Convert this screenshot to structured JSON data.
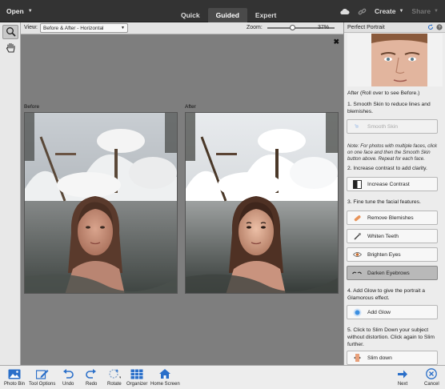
{
  "topbar": {
    "open_label": "Open",
    "modes": [
      "Quick",
      "Guided",
      "Expert"
    ],
    "active_mode": "Guided",
    "create_label": "Create",
    "share_label": "Share"
  },
  "options": {
    "view_label": "View:",
    "view_value": "Before & After - Horizontal",
    "zoom_label": "Zoom:",
    "zoom_value": "37%",
    "zoom_fraction": 0.37
  },
  "canvas": {
    "before_label": "Before",
    "after_label": "After"
  },
  "panel": {
    "title": "Perfect Portrait",
    "intro": "After (Roll over to see Before.)",
    "step1": "1. Smooth Skin to reduce lines and blemishes.",
    "smooth_skin": "Smooth Skin",
    "note": "Note: For photos with multiple faces, click on one face and then the Smooth Skin button above. Repeat for each face.",
    "step2": "2. Increase contrast to add clarity.",
    "increase_contrast": "Increase Contrast",
    "step3": "3. Fine tune the facial features.",
    "remove_blemishes": "Remove Blemishes",
    "whiten_teeth": "Whiten Teeth",
    "brighten_eyes": "Brighten Eyes",
    "darken_eyebrows": "Darken Eyebrows",
    "step4": "4. Add Glow to give the portrait a Glamorous effect.",
    "add_glow": "Add Glow",
    "step5": "5. Click to Slim Down your subject without distortion. Click again to Slim further.",
    "slim_down": "Slim down"
  },
  "bottombar": {
    "photo_bin": "Photo Bin",
    "tool_options": "Tool Options",
    "undo": "Undo",
    "redo": "Redo",
    "rotate": "Rotate",
    "organizer": "Organizer",
    "home_screen": "Home Screen",
    "next": "Next",
    "cancel": "Cancel"
  },
  "colors": {
    "accent_blue": "#2a6fc9",
    "topbar_bg": "#333333",
    "canvas_bg": "#7e7e7e",
    "panel_bg": "#ececec"
  },
  "icons": [
    "search-icon",
    "hand-icon",
    "cloud-icon",
    "link-icon",
    "help-icon",
    "refresh-icon",
    "photo-bin-icon",
    "tool-options-icon",
    "undo-icon",
    "redo-icon",
    "rotate-icon",
    "organizer-icon",
    "home-icon",
    "next-arrow-icon",
    "cancel-icon"
  ]
}
